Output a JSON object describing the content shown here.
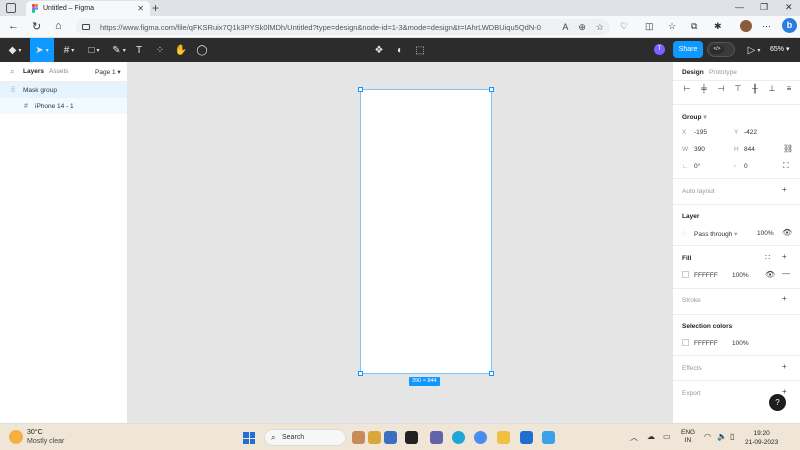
{
  "browser": {
    "tab_title": "Untitled – Figma",
    "url": "https://www.figma.com/file/qFKSRuix7Q1k3PYSk0lMDh/Untitled?type=design&node-id=1-3&mode=design&t=IAhrLWDBUiqu5QdN-0"
  },
  "figma": {
    "toolbar": {
      "avatar_initial": "T",
      "share_label": "Share",
      "zoom_label": "65%"
    },
    "left_panel": {
      "tabs": [
        "Layers",
        "Assets"
      ],
      "page_label": "Page 1",
      "layers": [
        {
          "name": "Mask group",
          "selected": true
        },
        {
          "name": "iPhone 14 - 1",
          "selected": false
        }
      ]
    },
    "canvas": {
      "dimension_badge": "390 × 844"
    },
    "right_panel": {
      "tabs": [
        "Design",
        "Prototype"
      ],
      "group_title": "Group",
      "x_label": "X",
      "x_value": "-195",
      "y_label": "Y",
      "y_value": "-422",
      "w_label": "W",
      "w_value": "390",
      "h_label": "H",
      "h_value": "844",
      "rotation_value": "0°",
      "radius_value": "0",
      "auto_layout": "Auto layout",
      "layer_title": "Layer",
      "blend_mode": "Pass through",
      "layer_opacity": "100%",
      "fill_title": "Fill",
      "fill_hex": "FFFFFF",
      "fill_opacity": "100%",
      "stroke_title": "Stroke",
      "selection_colors_title": "Selection colors",
      "sel_hex": "FFFFFF",
      "sel_opacity": "100%",
      "effects_title": "Effects",
      "export_title": "Export",
      "help": "?"
    }
  },
  "taskbar": {
    "temperature": "30°C",
    "weather": "Mostly clear",
    "search_label": "Search",
    "lang_line1": "ENG",
    "lang_line2": "IN",
    "time": "19:20",
    "date": "21-09-2023"
  },
  "colors": {
    "figma_blue": "#0d99ff",
    "toolbar_dark": "#2c2c2c",
    "canvas_bg": "#e5e5e5"
  }
}
